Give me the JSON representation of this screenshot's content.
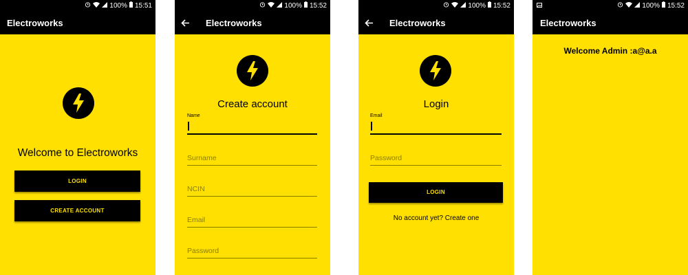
{
  "status": {
    "battery": "100%",
    "time1": "15:51",
    "time2": "15:52",
    "time3": "15:52",
    "time4": "15:52"
  },
  "app_title": "Electroworks",
  "colors": {
    "accent": "#FFE000",
    "bar": "#000000"
  },
  "icons": {
    "logo": "lightning-bolt-icon",
    "back": "arrow-left-icon"
  },
  "welcome_screen": {
    "heading": "Welcome to Electroworks",
    "login_button": "LOGIN",
    "create_account_button": "CREATE ACCOUNT"
  },
  "create_account_screen": {
    "heading": "Create account",
    "name_label": "Name",
    "surname_placeholder": "Surname",
    "ncin_placeholder": "NCIN",
    "email_placeholder": "Email",
    "password_placeholder": "Password"
  },
  "login_screen": {
    "heading": "Login",
    "email_label": "Email",
    "password_placeholder": "Password",
    "login_button": "LOGIN",
    "create_link": "No account yet? Create one"
  },
  "admin_screen": {
    "welcome_text": "Welcome Admin :a@a.a"
  }
}
